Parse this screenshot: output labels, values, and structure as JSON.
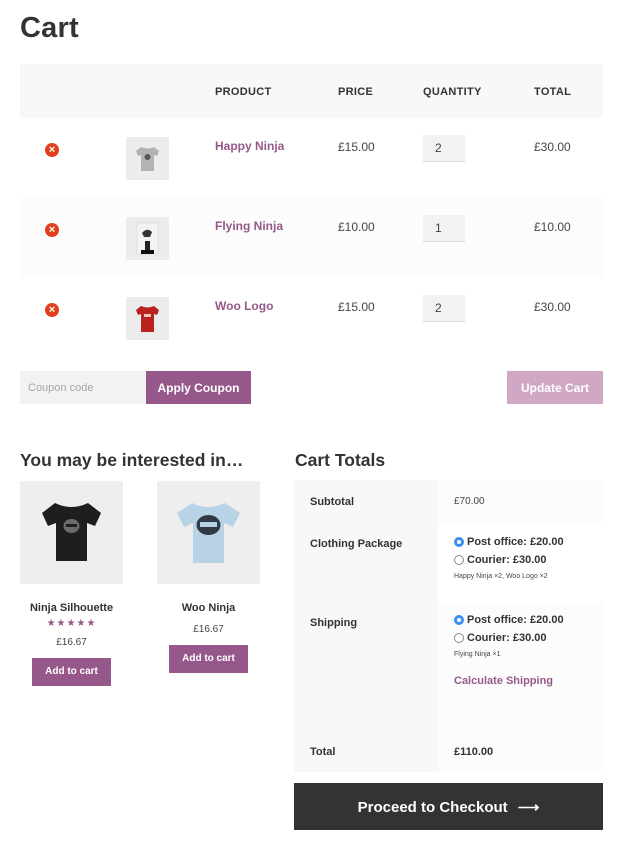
{
  "page": {
    "title": "Cart"
  },
  "cart": {
    "headers": {
      "product": "PRODUCT",
      "price": "PRICE",
      "quantity": "QUANTITY",
      "total": "TOTAL"
    },
    "items": [
      {
        "name": "Happy Ninja",
        "price": "£15.00",
        "quantity": "2",
        "total": "£30.00",
        "thumb_color": "#b8b8b8",
        "remove_icon": "remove-icon"
      },
      {
        "name": "Flying Ninja",
        "price": "£10.00",
        "quantity": "1",
        "total": "£10.00",
        "thumb_color": "#e0e0e0",
        "remove_icon": "remove-icon"
      },
      {
        "name": "Woo Logo",
        "price": "£15.00",
        "quantity": "2",
        "total": "£30.00",
        "thumb_color": "#b8231e",
        "remove_icon": "remove-icon"
      }
    ],
    "coupon": {
      "placeholder": "Coupon code",
      "apply_label": "Apply Coupon"
    },
    "update_label": "Update Cart"
  },
  "cross_sells": {
    "heading": "You may be interested in…",
    "products": [
      {
        "name": "Ninja Silhouette",
        "stars": "★★★★★",
        "price": "£16.67",
        "button": "Add to cart",
        "shirt_color": "#1e1e1e"
      },
      {
        "name": "Woo Ninja",
        "price": "£16.67",
        "button": "Add to cart",
        "shirt_color": "#b9d3e6"
      }
    ]
  },
  "totals": {
    "heading": "Cart Totals",
    "subtotal_label": "Subtotal",
    "subtotal_value": "£70.00",
    "clothing_label": "Clothing Package",
    "clothing_options": [
      "Post office: £20.00",
      "Courier: £30.00"
    ],
    "clothing_note": "Happy Ninja ×2, Woo Logo ×2",
    "shipping_label": "Shipping",
    "shipping_options": [
      "Post office: £20.00",
      "Courier: £30.00"
    ],
    "shipping_note": "Flying Ninja ×1",
    "calculate_label": "Calculate Shipping",
    "total_label": "Total",
    "total_value": "£110.00"
  },
  "checkout": {
    "label": "Proceed to Checkout",
    "arrow": "⟶"
  },
  "colors": {
    "accent": "#96588a",
    "accent_light": "#d0a8c6",
    "remove": "#e2401c",
    "dark": "#333333",
    "radio": "#3a8ff0"
  }
}
